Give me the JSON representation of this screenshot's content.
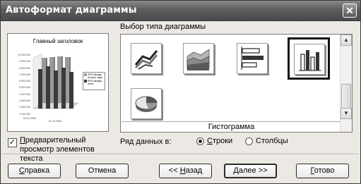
{
  "window": {
    "title": "Автоформат диаграммы",
    "close_glyph": "✕"
  },
  "preview": {
    "chart_title": "Главный заголовок",
    "y_tick_labels": [
      "10 000 000",
      "9 000 000",
      "8 000 000",
      "7 000 000",
      "6 000 000",
      "5 000 000",
      "4 000 000",
      "3 000 000",
      "2 000 000",
      "1 000 000",
      "0"
    ],
    "x_tick_labels": [
      "01.01.2006",
      "01.10.2006"
    ],
    "legend": [
      "ФТ02 Вклады, которые чаще",
      "ФТ02 Вклады, счета"
    ],
    "series_colors": [
      "#9a9a9a",
      "#3a3a3a"
    ]
  },
  "checkbox": {
    "label_underlined": "П",
    "label_rest": "редварительный просмотр элементов текста",
    "checked": true,
    "check_glyph": "✓"
  },
  "gallery": {
    "label": "Выбор типа диаграммы",
    "caption": "Гистограмма",
    "items": [
      {
        "icon": "flow-3d-icon",
        "selected": false
      },
      {
        "icon": "area-3d-icon",
        "selected": false
      },
      {
        "icon": "bar-horizontal-3d-icon",
        "selected": false
      },
      {
        "icon": "column-3d-icon",
        "selected": true
      },
      {
        "icon": "pie-3d-icon",
        "selected": false
      }
    ],
    "scroll_up_glyph": "▲",
    "scroll_down_glyph": "▼"
  },
  "series": {
    "label": "Ряд данных в:",
    "options": [
      {
        "underlined": "С",
        "rest": "троки",
        "selected": true
      },
      {
        "underlined": "",
        "rest": "Столбцы",
        "selected": false
      }
    ]
  },
  "buttons": {
    "help": {
      "underlined": "С",
      "rest": "правка"
    },
    "cancel": {
      "underlined": "",
      "rest": "Отмена"
    },
    "back": {
      "prefix": "<< ",
      "underlined": "Н",
      "rest": "азад"
    },
    "next": {
      "underlined": "Д",
      "rest": "алее >>"
    },
    "done": {
      "underlined": "Г",
      "rest": "отово"
    }
  },
  "colors": {
    "title_bar": "#5c5c5c",
    "dialog_bg": "#ece9e4",
    "selection_border": "#111111"
  }
}
